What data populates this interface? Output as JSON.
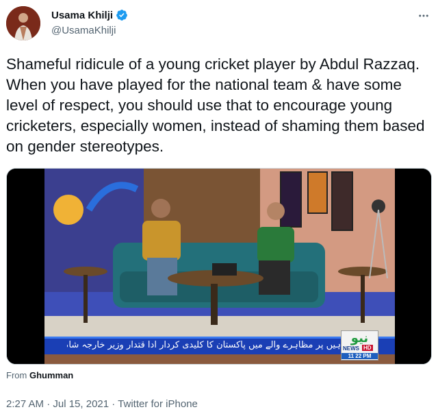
{
  "author": {
    "display_name": "Usama Khilji",
    "handle": "@UsamaKhilji",
    "verified": true,
    "avatar_icon": "profile-photo"
  },
  "more_icon": "ellipsis-icon",
  "tweet_text": "Shameful ridicule of a young cricket player by Abdul Razzaq. When you have played for the national team & have some level of respect, you should use that to encourage young cricketers, especially women, instead of shaming them based on gender stereotypes.",
  "media": {
    "channel_logo_urdu": "نیو",
    "channel_logo_news": "NEWS",
    "channel_logo_hd": "HD",
    "channel_time": "11  22 PM",
    "ticker_text": "ہیں پر مظاہرے والے میں پاکستان کا کلیدی کردار ادا قتدار وزیر خارجہ شاہ محمود قریشی"
  },
  "source": {
    "prefix": "From",
    "name": "Ghumman"
  },
  "meta": "2:27 AM · Jul 15, 2021 · Twitter for iPhone",
  "colors": {
    "verified_blue": "#1d9bf0",
    "secondary_text": "#536471",
    "primary_text": "#0f1419"
  }
}
